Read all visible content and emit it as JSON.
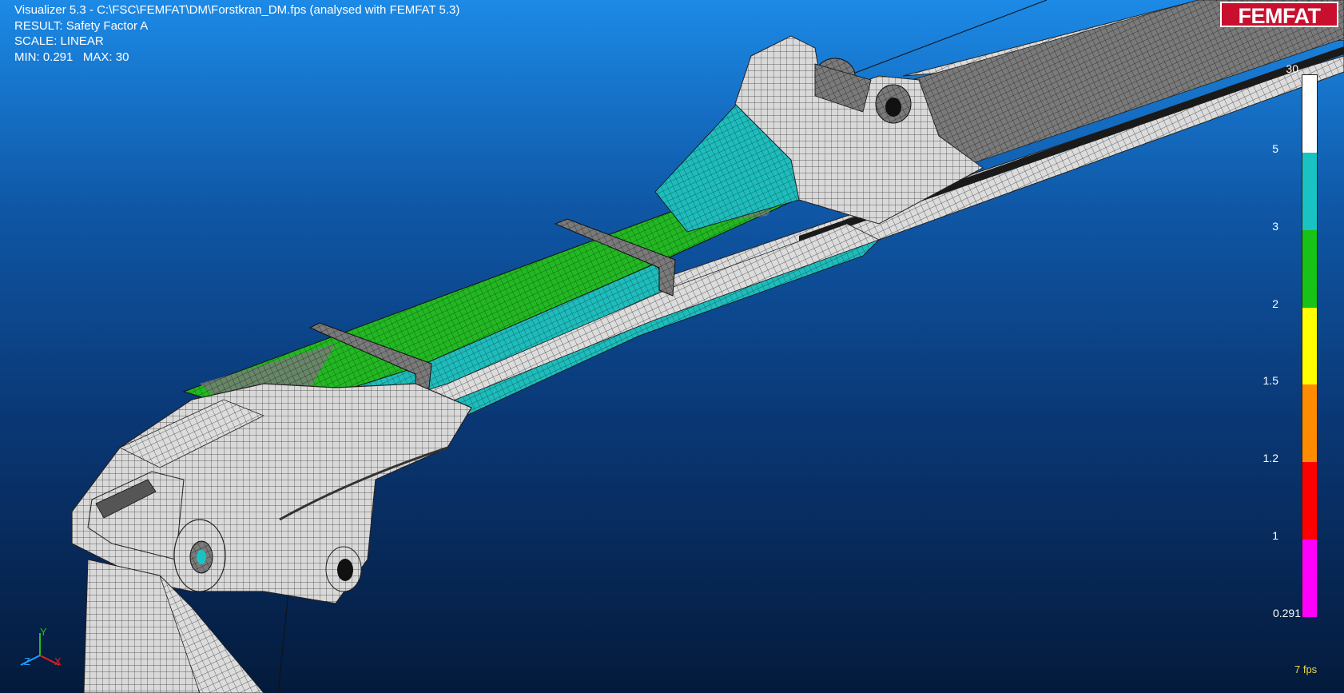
{
  "header": {
    "line1": "Visualizer 5.3 - C:\\FSC\\FEMFAT\\DM\\Forstkran_DM.fps (analysed with FEMFAT 5.3)",
    "line2": "RESULT: Safety Factor A",
    "line3": "SCALE: LINEAR",
    "min_label": "MIN: 0.291",
    "max_label": "MAX: 30"
  },
  "logo": {
    "text": "FEMFAT"
  },
  "legend": {
    "top_label": "30",
    "ticks": [
      "5",
      "3",
      "2",
      "1.5",
      "1.2",
      "1",
      "0.291"
    ],
    "colors": [
      "#ffffff",
      "#19c3c3",
      "#16c316",
      "#ffff00",
      "#ff8c00",
      "#ff0000",
      "#ff00ff"
    ]
  },
  "status": {
    "fps": "7 fps"
  },
  "axes": {
    "y": "Y",
    "z": "Z",
    "x": "X"
  },
  "colors": {
    "bg_top": "#1c8ae6",
    "bg_bottom": "#041a3b",
    "mesh_white": "#d9d9d9",
    "mesh_green": "#1fb31f",
    "mesh_cyan": "#19c3c3",
    "logo_red": "#c8102e"
  }
}
